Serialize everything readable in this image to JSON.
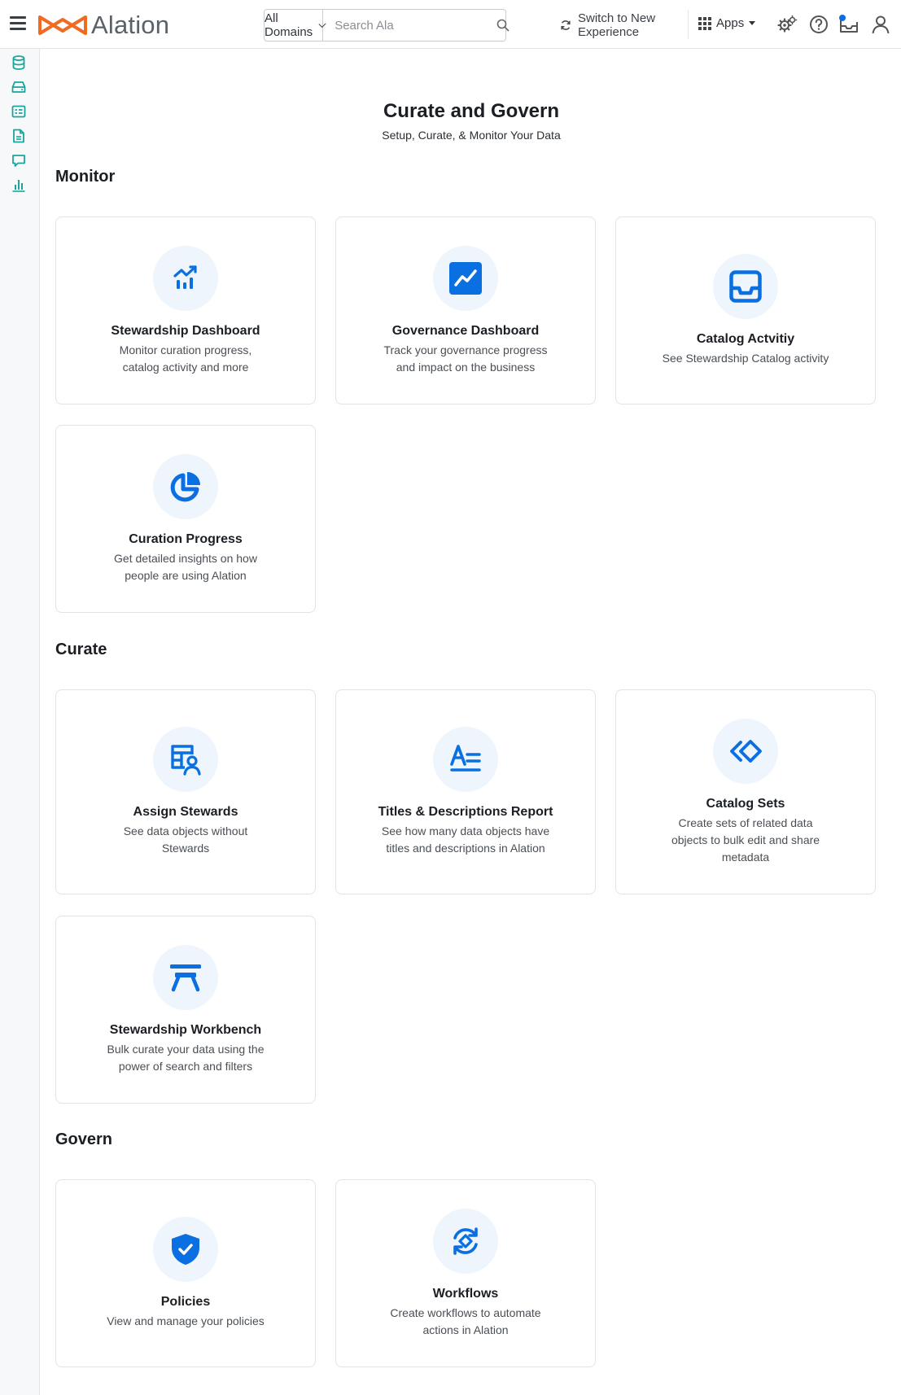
{
  "topbar": {
    "logo_text": "Alation",
    "domains_label": "All Domains",
    "search_placeholder": "Search Ala",
    "switch_line1": "Switch to New",
    "switch_line2": "Experience",
    "apps_label": "Apps"
  },
  "colors": {
    "accent": "#0a6fe0",
    "logo_orange": "#f06a22",
    "rail_green": "#1aa59b",
    "icon_bg": "#eef5fd"
  },
  "rail": {
    "icons": [
      "database-icon",
      "storage-icon",
      "table-icon",
      "document-icon",
      "chat-icon",
      "bar-chart-icon"
    ]
  },
  "page": {
    "title": "Curate and Govern",
    "subtitle": "Setup, Curate, & Monitor Your Data"
  },
  "sections": {
    "monitor": {
      "title": "Monitor",
      "cards": [
        {
          "icon": "trend-chart-icon",
          "title": "Stewardship Dashboard",
          "desc_1": "Monitor curation progress,",
          "desc_2": "catalog activity and more"
        },
        {
          "icon": "line-chart-icon",
          "title": "Governance Dashboard",
          "desc_1": "Track your governance progress",
          "desc_2": "and impact on the business"
        },
        {
          "icon": "inbox-icon",
          "title": "Catalog Actvitiy",
          "desc_1": "See Stewardship Catalog activity",
          "desc_2": ""
        },
        {
          "icon": "pie-chart-icon",
          "title": "Curation Progress",
          "desc_1": "Get detailed insights on how",
          "desc_2": "people are using Alation"
        }
      ]
    },
    "curate": {
      "title": "Curate",
      "cards": [
        {
          "icon": "assign-user-icon",
          "title": "Assign Stewards",
          "desc_1": "See data objects without",
          "desc_2": "Stewards",
          "desc_3": ""
        },
        {
          "icon": "text-format-icon",
          "title": "Titles & Descriptions Report",
          "desc_1": "See how many data objects have",
          "desc_2": "titles and descriptions in Alation",
          "desc_3": ""
        },
        {
          "icon": "catalog-sets-icon",
          "title": "Catalog Sets",
          "desc_1": "Create sets of related data",
          "desc_2": "objects to bulk edit and share",
          "desc_3": "metadata"
        },
        {
          "icon": "workbench-icon",
          "title": "Stewardship Workbench",
          "desc_1": "Bulk curate your data using the",
          "desc_2": "power of search and filters",
          "desc_3": ""
        }
      ]
    },
    "govern": {
      "title": "Govern",
      "cards": [
        {
          "icon": "shield-check-icon",
          "title": "Policies",
          "desc_1": "View and manage your policies",
          "desc_2": ""
        },
        {
          "icon": "workflow-cycle-icon",
          "title": "Workflows",
          "desc_1": "Create workflows to automate",
          "desc_2": "actions in Alation"
        }
      ]
    }
  }
}
